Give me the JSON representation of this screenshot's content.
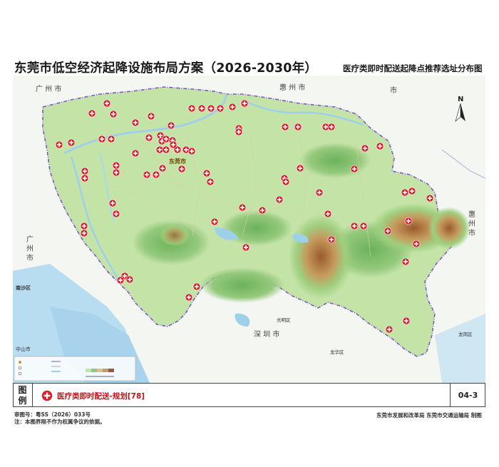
{
  "title": "东莞市低空经济起降设施布局方案（2026-2030年）",
  "subtitle": "医疗类即时配送起降点推荐选址分布图",
  "map_labels": {
    "guangzhou_top": "广 州 市",
    "huizhou_top": "惠 州 市",
    "guangzhou_left": "广 州 市",
    "nansha": "南沙区",
    "zhongshan": "中山市",
    "shenzhen": "深 圳 市",
    "guangming": "光明区",
    "longhua": "龙华区",
    "longgang": "龙岗区",
    "huizhou_right": "惠 州 市",
    "dongguan": "东莞市"
  },
  "colors": {
    "marker": "#d8202b",
    "boundary": "#7b5bc4",
    "water": "#aed7ef",
    "lowland": "#bfe0a6",
    "hill": "#8fc878",
    "mountain": "#b37c4a"
  },
  "north_label": "N",
  "legend": {
    "label": "图\n例",
    "item_text": "医疗类即时配送-规划[78]",
    "code": "04-3",
    "marker_icon": "red-cross-circle-icon"
  },
  "footer": {
    "approval": "审图号：粤SS（2026）033号",
    "note": "注：本图界限不作为权属争议的依据。",
    "producer": "东莞市发展和改革局  东莞市交通运输局  制图"
  },
  "points": [
    [
      150,
      145
    ],
    [
      129,
      159
    ],
    [
      159,
      160
    ],
    [
      212,
      163
    ],
    [
      190,
      172
    ],
    [
      269,
      152
    ],
    [
      283,
      152
    ],
    [
      296,
      152
    ],
    [
      309,
      152
    ],
    [
      326,
      150
    ],
    [
      343,
      145
    ],
    [
      240,
      176
    ],
    [
      225,
      190
    ],
    [
      83,
      203
    ],
    [
      100,
      200
    ],
    [
      143,
      195
    ],
    [
      156,
      195
    ],
    [
      209,
      193
    ],
    [
      227,
      198
    ],
    [
      233,
      195
    ],
    [
      242,
      197
    ],
    [
      224,
      210
    ],
    [
      233,
      210
    ],
    [
      249,
      210
    ],
    [
      261,
      210
    ],
    [
      269,
      212
    ],
    [
      243,
      203
    ],
    [
      190,
      215
    ],
    [
      163,
      232
    ],
    [
      163,
      242
    ],
    [
      119,
      240
    ],
    [
      119,
      250
    ],
    [
      206,
      245
    ],
    [
      219,
      245
    ],
    [
      228,
      236
    ],
    [
      255,
      237
    ],
    [
      290,
      243
    ],
    [
      295,
      255
    ],
    [
      335,
      180
    ],
    [
      335,
      185
    ],
    [
      400,
      178
    ],
    [
      418,
      178
    ],
    [
      457,
      178
    ],
    [
      465,
      178
    ],
    [
      497,
      237
    ],
    [
      512,
      208
    ],
    [
      533,
      205
    ],
    [
      399,
      250
    ],
    [
      401,
      255
    ],
    [
      421,
      236
    ],
    [
      392,
      280
    ],
    [
      448,
      270
    ],
    [
      568,
      270
    ],
    [
      578,
      268
    ],
    [
      158,
      285
    ],
    [
      163,
      300
    ],
    [
      118,
      317
    ],
    [
      118,
      327
    ],
    [
      301,
      311
    ],
    [
      340,
      291
    ],
    [
      368,
      295
    ],
    [
      460,
      300
    ],
    [
      465,
      336
    ],
    [
      497,
      317
    ],
    [
      510,
      317
    ],
    [
      603,
      278
    ],
    [
      573,
      310
    ],
    [
      544,
      324
    ],
    [
      584,
      342
    ],
    [
      345,
      347
    ],
    [
      175,
      387
    ],
    [
      169,
      393
    ],
    [
      182,
      392
    ],
    [
      276,
      402
    ],
    [
      265,
      417
    ],
    [
      569,
      367
    ],
    [
      570,
      450
    ],
    [
      546,
      462
    ]
  ]
}
